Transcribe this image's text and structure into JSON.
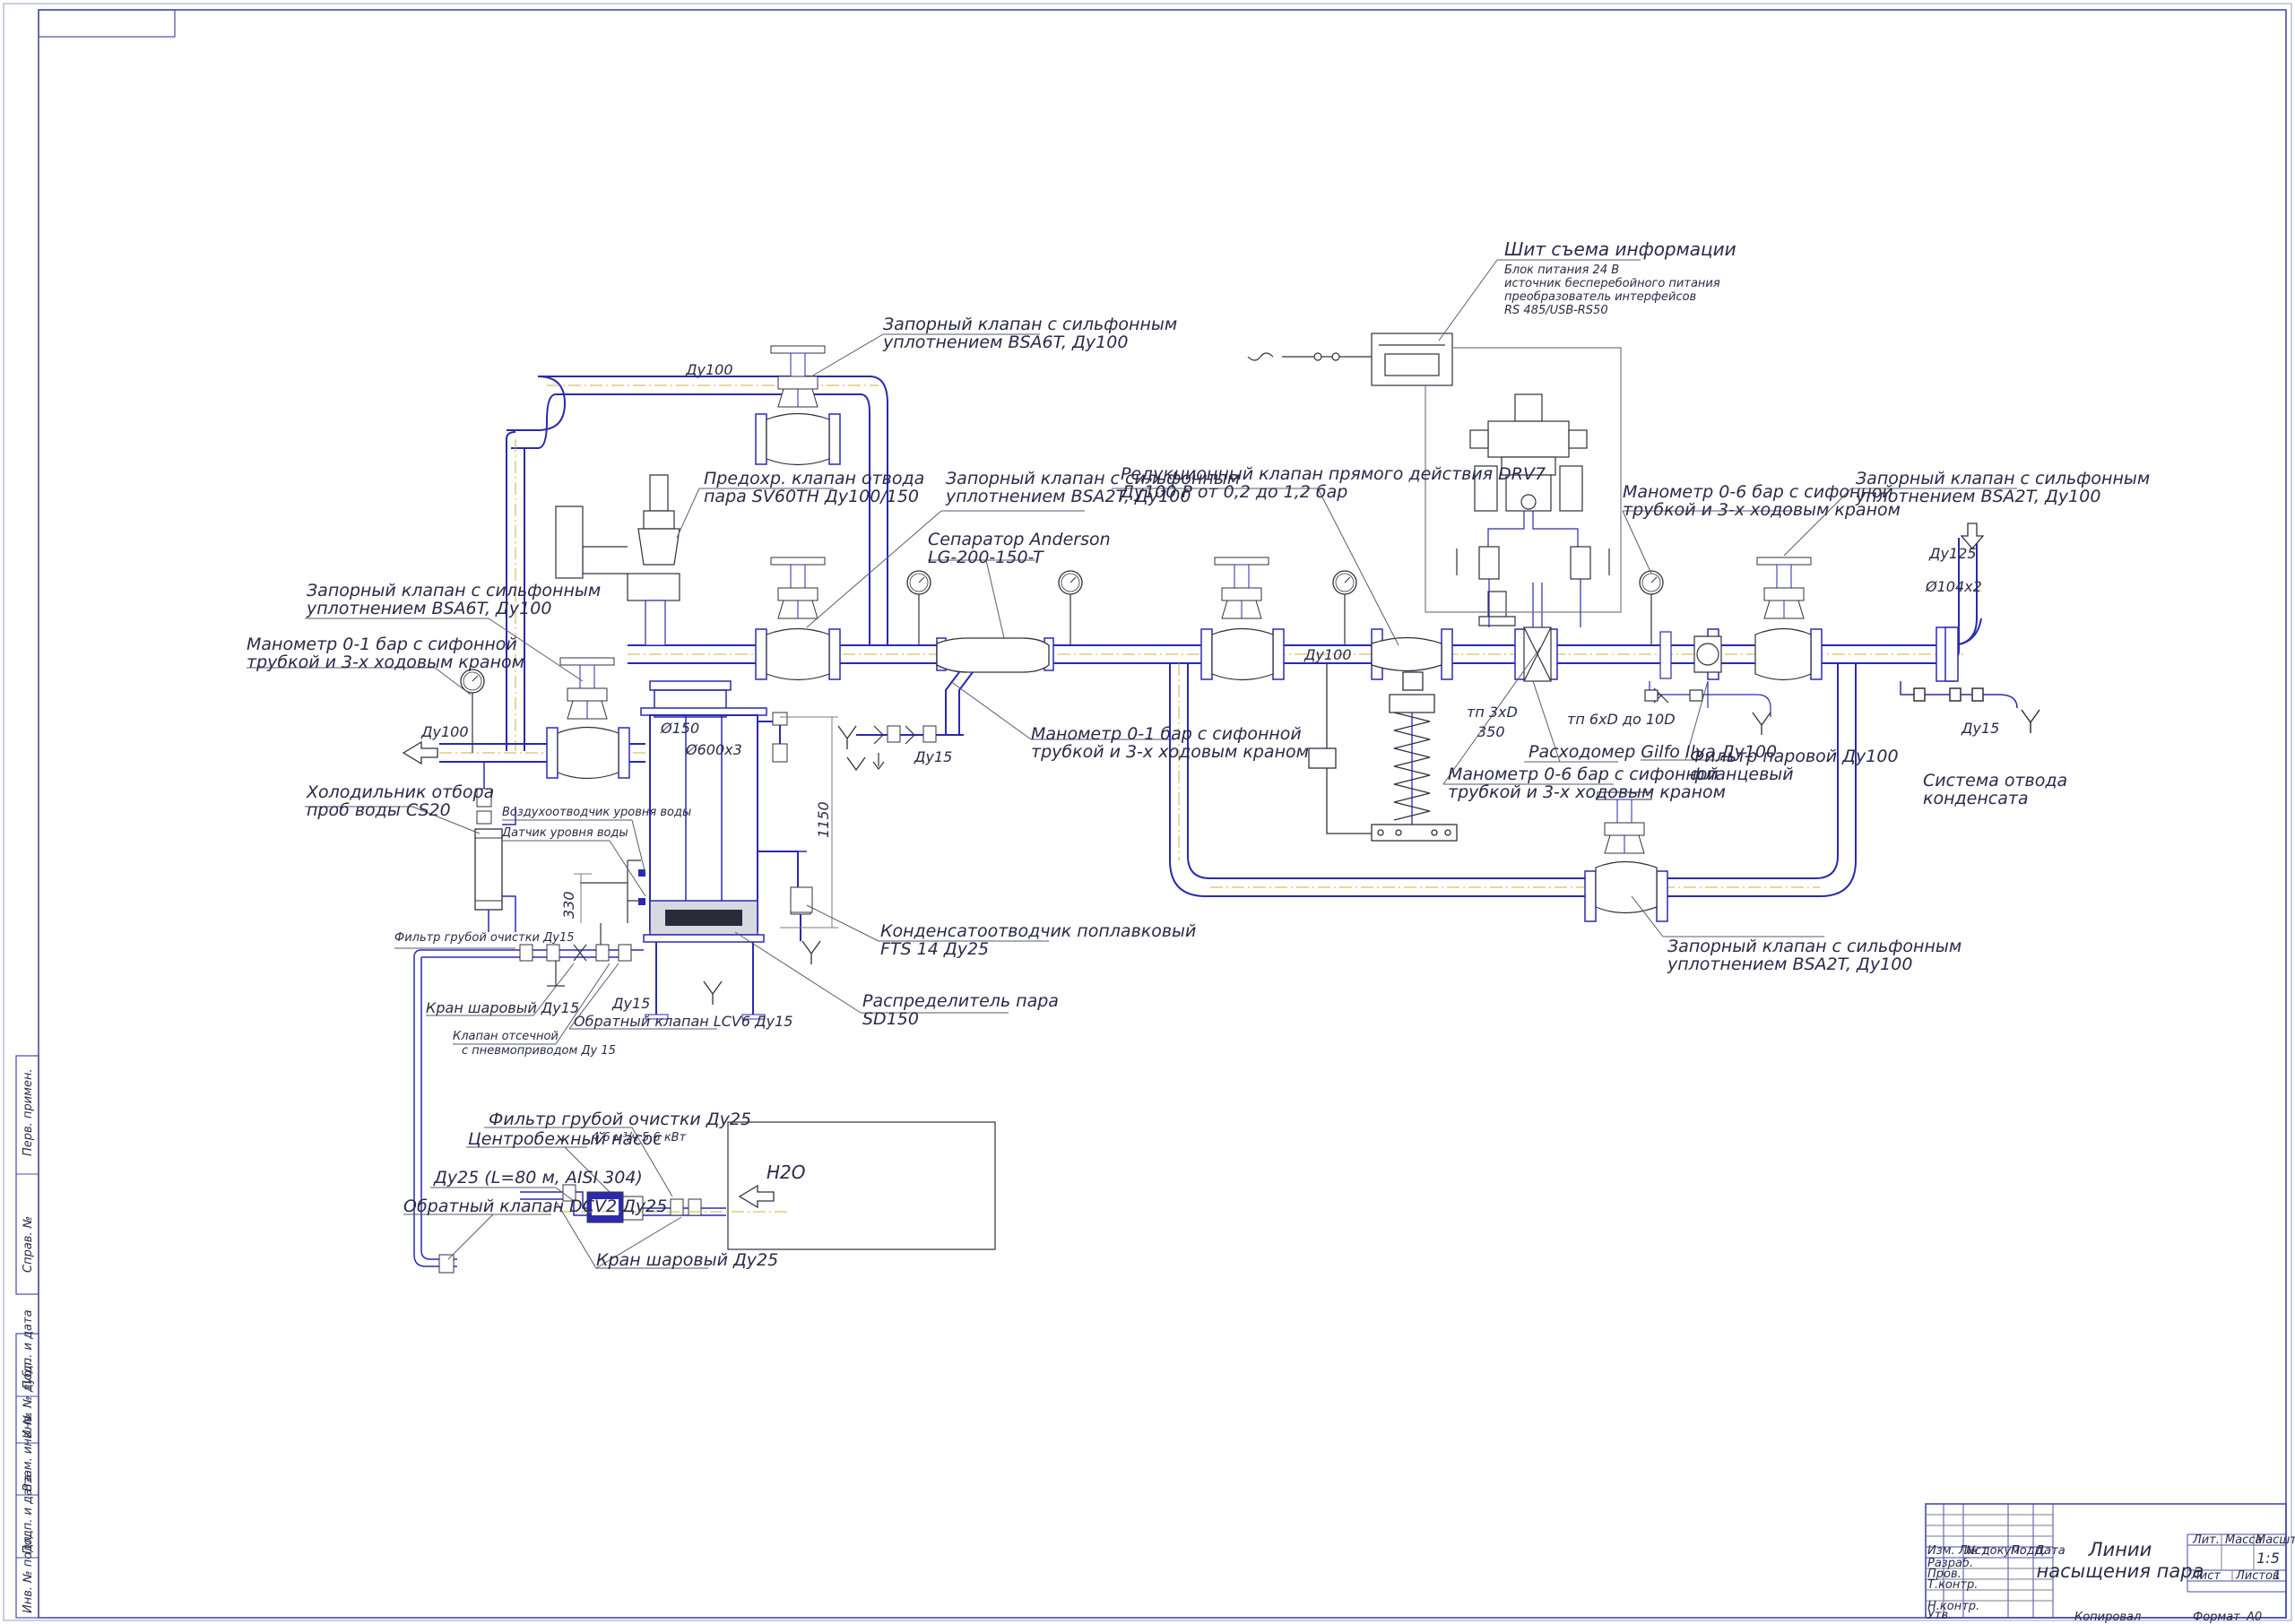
{
  "drawing": {
    "title_line1": "Линии",
    "title_line2": "насыщения пара",
    "sheet_format": "Формат",
    "sheet_format_value": "А0",
    "copied": "Копировал",
    "scale": "1:5",
    "title_block_headers": {
      "lit": "Лит.",
      "mass": "Масса",
      "scale": "Масштаб",
      "sheet": "Лист",
      "sheets": "Листов",
      "sheets_value": "1"
    },
    "title_block_rows": [
      "Изм. Лист",
      "№ докум.",
      "Подп.",
      "Дата",
      "Разраб.",
      "Пров.",
      "Т.контр.",
      "Н.контр.",
      "Утв."
    ],
    "side_stamp": [
      "Перв. примен.",
      "Справ. №",
      "Подп. и дата",
      "Инв. № дубл.",
      "Взам. инв. №",
      "Подп. и дата",
      "Инв. № подл."
    ]
  },
  "labels": {
    "valve_bsa6t_top_1": "Запорный клапан с сильфонным",
    "valve_bsa6t_top_2": "уплотнением BSA6T, Ду100",
    "safety_valve_1": "Предохр. клапан отвода",
    "safety_valve_2": "пара SV60TH Ду100/150",
    "valve_bsa2t_mid_1": "Запорный клапан с сильфонным",
    "valve_bsa2t_mid_2": "уплотнением BSA2T, Ду100",
    "reducing_valve_1": "Редукционный клапан прямого действия DRV7",
    "reducing_valve_2": "Ду100 P от 0,2 до 1,2 бар",
    "separator_1": "Сепаратор Anderson",
    "separator_2": "LG-200-150-T",
    "valve_bsa6t_left_1": "Запорный клапан с сильфонным",
    "valve_bsa6t_left_2": "уплотнением BSA6T, Ду100",
    "manometer_01_left_1": "Манометр 0-1 бар с сифонной",
    "manometer_01_left_2": "трубкой и 3-х ходовым краном",
    "manometer_01_mid_1": "Манометр 0-1 бар с сифонной",
    "manometer_01_mid_2": "трубкой и 3-х ходовым краном",
    "manometer_06_right_1": "Манометр 0-6 бар с сифонной",
    "manometer_06_right_2": "трубкой и 3-х ходовым краном",
    "manometer_06_low_1": "Манометр 0-6 бар с сифонной",
    "manometer_06_low_2": "трубкой и 3-х ходовым краном",
    "valve_bsa2t_right_1": "Запорный клапан с сильфонным",
    "valve_bsa2t_right_2": "уплотнением BSA2T, Ду100",
    "valve_bsa2t_bottom_1": "Запорный клапан с сильфонным",
    "valve_bsa2t_bottom_2": "уплотнением BSA2T, Ду100",
    "info_panel_title": "Шит съема информации",
    "info_panel_line1": "Блок питания 24 В",
    "info_panel_line2": "источник бесперебойного питания",
    "info_panel_line3": "преобразователь интерфейсов",
    "info_panel_line4": "RS 485/USB-RS50",
    "flowmeter": "Расходомер Gilfo Ilva Ду100",
    "steam_filter_1": "Фильтр паровой Ду100",
    "steam_filter_2": "фланцевый",
    "condensate_system_1": "Система отвода",
    "condensate_system_2": "конденсата",
    "cooler_1": "Холодильник отбора",
    "cooler_2": "проб воды CS20",
    "deaerator_level": "Воздухоотводчик уровня воды",
    "water_level_sensor": "Датчик уровня воды",
    "coarse_filter_15": "Фильтр грубой очистки Ду15",
    "ball_valve_15": "Кран шаровый Ду15",
    "shutoff_valve_1": "Клапан отсечной",
    "shutoff_valve_2": "с пневмоприводом Ду 15",
    "check_valve_lcv6": "Обратный клапан LCV6 Ду15",
    "float_trap_1": "Конденсатоотводчик поплавковый",
    "float_trap_2": "FTS 14 Ду25",
    "distributor_1": "Распределитель пара",
    "distributor_2": "SD150",
    "coarse_filter_25": "Фильтр грубой очистки Ду25",
    "centrifugal_pump": "Центробежный насос",
    "pump_spec": "4,6 м³/ч 5,6 кВт",
    "pipe_spec": "Ду25 (L=80 м, AISI 304)",
    "check_valve_dcv2": "Обратный клапан DCV2 Ду25",
    "ball_valve_25": "Кран шаровый Ду25",
    "water_tank": "H2O",
    "dy100_top": "Ду100",
    "dy100_left": "Ду100",
    "dy100_mid": "Ду100",
    "dy15_a": "Ду15",
    "dy15_b": "Ду15",
    "dy15_c": "Ду15",
    "dy125": "Ду125",
    "d104": "Ø104х2",
    "d150": "Ø150",
    "d600": "Ø600х3",
    "dim_1150": "1150",
    "dim_330": "330",
    "dim_350": "350",
    "tp_3d": "тп 3хD",
    "tp_6d": "тп 6хD до 10D"
  }
}
